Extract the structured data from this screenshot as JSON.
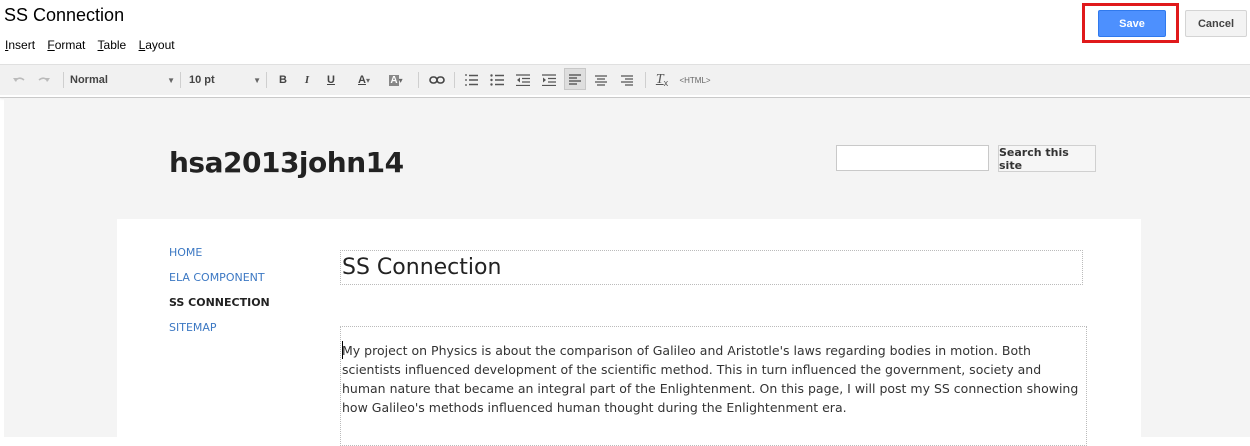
{
  "editor": {
    "page_name": "SS Connection",
    "menu": [
      {
        "first": "I",
        "rest": "nsert"
      },
      {
        "first": "F",
        "rest": "ormat"
      },
      {
        "first": "T",
        "rest": "able"
      },
      {
        "first": "L",
        "rest": "ayout"
      }
    ],
    "save_label": "Save",
    "cancel_label": "Cancel",
    "toolbar": {
      "style_value": "Normal",
      "size_value": "10 pt",
      "bold": "B",
      "italic": "I",
      "underline": "U",
      "text_color": "A",
      "highlight": "A",
      "html_label": "<HTML>"
    }
  },
  "site": {
    "title": "hsa2013john14",
    "search_button": "Search this site",
    "nav": [
      "HOME",
      "ELA COMPONENT",
      "SS CONNECTION",
      "SITEMAP"
    ],
    "active_nav_index": 2
  },
  "page": {
    "heading": "SS Connection",
    "body_lines": [
      "My project on Physics is about the comparison of Galileo and Aristotle's laws regarding bodies in motion.  Both",
      "scientists influenced development of the scientific method.  This in turn influenced the government, society and",
      "human nature that became an integral part of the Enlightenment. On this page, I will post my SS connection showing",
      "how Galileo's methods influenced human thought during the Enlightenment era."
    ]
  },
  "colors": {
    "save_blue": "#4d90fe",
    "highlight_red": "#e0191b",
    "link_blue": "#3c78c3"
  }
}
